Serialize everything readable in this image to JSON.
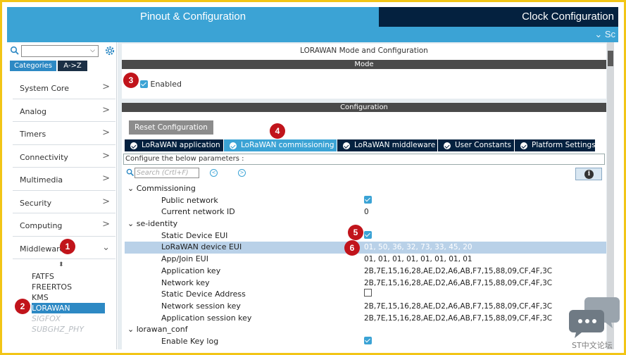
{
  "header": {
    "tab_pinout": "Pinout & Configuration",
    "tab_clock": "Clock Configuration",
    "subbar_text": "⌄ Sc"
  },
  "sidebar": {
    "tabs": [
      "Categories",
      "A->Z"
    ],
    "categories": [
      {
        "label": "System Core",
        "arrow": ">"
      },
      {
        "label": "Analog",
        "arrow": ">"
      },
      {
        "label": "Timers",
        "arrow": ">"
      },
      {
        "label": "Connectivity",
        "arrow": ">"
      },
      {
        "label": "Multimedia",
        "arrow": ">"
      },
      {
        "label": "Security",
        "arrow": ">"
      },
      {
        "label": "Computing",
        "arrow": ">"
      },
      {
        "label": "Middleware",
        "arrow": "⌄"
      }
    ],
    "middleware": [
      {
        "label": "FATFS",
        "state": "normal"
      },
      {
        "label": "FREERTOS",
        "state": "normal"
      },
      {
        "label": "KMS",
        "state": "normal"
      },
      {
        "label": "LORAWAN",
        "state": "selected"
      },
      {
        "label": "SIGFOX",
        "state": "disabled"
      },
      {
        "label": "SUBGHZ_PHY",
        "state": "disabled"
      }
    ]
  },
  "mode": {
    "title": "LORAWAN Mode and Configuration",
    "section": "Mode",
    "enabled_label": "Enabled",
    "enabled": true
  },
  "config": {
    "section": "Configuration",
    "reset_label": "Reset Configuration",
    "tabs": [
      {
        "label": "LoRaWAN application",
        "active": false
      },
      {
        "label": "LoRaWAN commissioning",
        "active": true
      },
      {
        "label": "LoRaWAN middleware",
        "active": false
      },
      {
        "label": "User Constants",
        "active": false
      },
      {
        "label": "Platform Settings",
        "active": false
      }
    ],
    "hint": "Configure the below parameters :",
    "search_placeholder": "Search (Crtl+F)",
    "params": [
      {
        "type": "group",
        "label": "Commissioning"
      },
      {
        "type": "param",
        "label": "Public network",
        "value": "",
        "checkbox": "checked"
      },
      {
        "type": "param",
        "label": "Current network ID",
        "value": "0"
      },
      {
        "type": "group",
        "label": "se-identity"
      },
      {
        "type": "param",
        "label": "Static Device EUI",
        "value": "",
        "checkbox": "checked"
      },
      {
        "type": "param",
        "label": "LoRaWAN device EUI",
        "value": "01, 50, 36, 32, 73, 33, 45, 20",
        "selected": true
      },
      {
        "type": "param",
        "label": "App/Join EUI",
        "value": "01, 01, 01, 01, 01, 01, 01, 01"
      },
      {
        "type": "param",
        "label": "Application key",
        "value": "2B,7E,15,16,28,AE,D2,A6,AB,F7,15,88,09,CF,4F,3C"
      },
      {
        "type": "param",
        "label": "Network key",
        "value": "2B,7E,15,16,28,AE,D2,A6,AB,F7,15,88,09,CF,4F,3C"
      },
      {
        "type": "param",
        "label": "Static Device Address",
        "value": "",
        "checkbox": "empty"
      },
      {
        "type": "param",
        "label": "Network session key",
        "value": "2B,7E,15,16,28,AE,D2,A6,AB,F7,15,88,09,CF,4F,3C"
      },
      {
        "type": "param",
        "label": "Application session key",
        "value": "2B,7E,15,16,28,AE,D2,A6,AB,F7,15,88,09,CF,4F,3C"
      },
      {
        "type": "group",
        "label": "lorawan_conf"
      },
      {
        "type": "param",
        "label": "Enable Key log",
        "value": "",
        "checkbox": "checked"
      }
    ]
  },
  "callouts": [
    "1",
    "2",
    "3",
    "4",
    "5",
    "6"
  ],
  "watermark": "ST中文论坛",
  "colors": {
    "accent": "#3ba3d5",
    "dark_navy": "#04213f",
    "callout_red": "#c1141b",
    "frame_yellow": "#f2c516"
  }
}
